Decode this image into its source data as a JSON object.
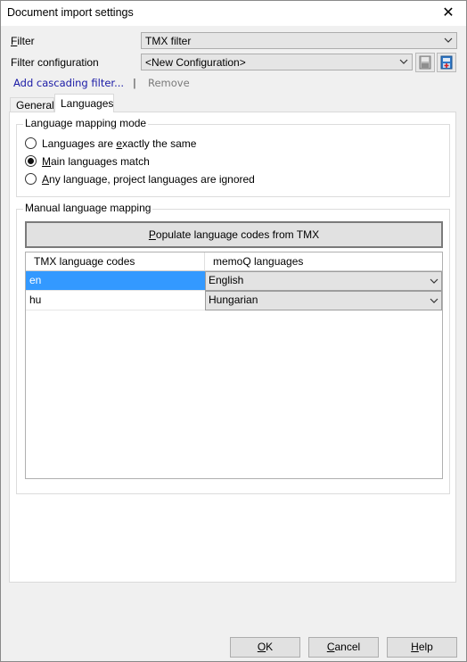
{
  "window": {
    "title": "Document import settings"
  },
  "filter": {
    "label": "Filter",
    "value": "TMX filter"
  },
  "filter_config": {
    "label": "Filter configuration",
    "value": "<New Configuration>"
  },
  "links": {
    "add_cascading": "Add cascading filter...",
    "separator": "|",
    "remove": "Remove"
  },
  "tabs": [
    {
      "label": "General"
    },
    {
      "label": "Languages"
    }
  ],
  "mode_group": {
    "title": "Language mapping mode",
    "options": [
      {
        "label": "Languages are exactly the same",
        "checked": false
      },
      {
        "label": "Main languages match",
        "checked": true
      },
      {
        "label": "Any language, project languages are ignored",
        "checked": false
      }
    ]
  },
  "manual_group": {
    "title": "Manual language mapping",
    "populate_button": "Populate language codes from TMX",
    "columns": [
      "TMX language codes",
      "memoQ languages"
    ],
    "rows": [
      {
        "code": "en",
        "language": "English",
        "selected": true
      },
      {
        "code": "hu",
        "language": "Hungarian",
        "selected": false
      }
    ]
  },
  "buttons": {
    "ok": "OK",
    "cancel": "Cancel",
    "help": "Help"
  },
  "colors": {
    "selection": "#3399ff",
    "link": "#1a1aa6",
    "disabled": "#7a7a7a"
  },
  "icons": [
    "close-icon",
    "chevron-down-icon",
    "save-config-icon",
    "new-config-icon"
  ]
}
